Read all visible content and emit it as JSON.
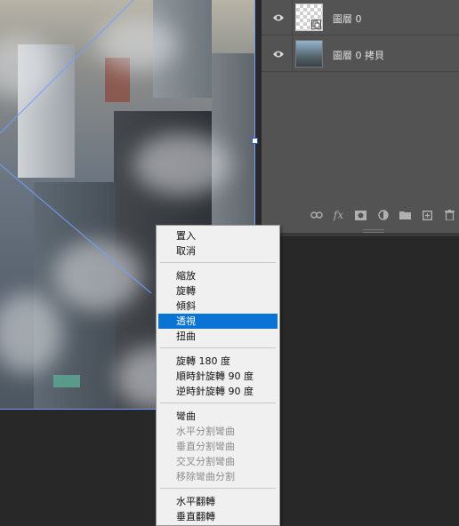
{
  "layers_panel": {
    "layers": [
      {
        "name": "圖層 0",
        "visible": true,
        "thumbnail": "transparent-checkerboard",
        "smart_object": true
      },
      {
        "name": "圖層 0 拷貝",
        "visible": true,
        "thumbnail": "city-photo",
        "smart_object": false
      }
    ],
    "footer_icons": [
      "link-icon",
      "fx-icon",
      "mask-icon",
      "adjustment-icon",
      "folder-icon",
      "new-layer-icon",
      "trash-icon"
    ],
    "fx_label": "fx"
  },
  "context_menu": {
    "sections": [
      {
        "items": [
          {
            "label": "置入",
            "enabled": true,
            "highlighted": false
          },
          {
            "label": "取消",
            "enabled": true,
            "highlighted": false
          }
        ]
      },
      {
        "items": [
          {
            "label": "縮放",
            "enabled": true,
            "highlighted": false
          },
          {
            "label": "旋轉",
            "enabled": true,
            "highlighted": false
          },
          {
            "label": "傾斜",
            "enabled": true,
            "highlighted": false
          },
          {
            "label": "透視",
            "enabled": true,
            "highlighted": true
          },
          {
            "label": "扭曲",
            "enabled": true,
            "highlighted": false
          }
        ]
      },
      {
        "items": [
          {
            "label": "旋轉 180 度",
            "enabled": true,
            "highlighted": false
          },
          {
            "label": "順時針旋轉 90 度",
            "enabled": true,
            "highlighted": false
          },
          {
            "label": "逆時針旋轉 90 度",
            "enabled": true,
            "highlighted": false
          }
        ]
      },
      {
        "items": [
          {
            "label": "彎曲",
            "enabled": true,
            "highlighted": false
          },
          {
            "label": "水平分割彎曲",
            "enabled": false,
            "highlighted": false
          },
          {
            "label": "垂直分割彎曲",
            "enabled": false,
            "highlighted": false
          },
          {
            "label": "交叉分割彎曲",
            "enabled": false,
            "highlighted": false
          },
          {
            "label": "移除彎曲分割",
            "enabled": false,
            "highlighted": false
          }
        ]
      },
      {
        "items": [
          {
            "label": "水平翻轉",
            "enabled": true,
            "highlighted": false
          },
          {
            "label": "垂直翻轉",
            "enabled": true,
            "highlighted": false
          }
        ]
      }
    ]
  },
  "colors": {
    "highlight": "#0a74d4",
    "transform_line": "#6fa0ff",
    "panel_bg": "#535353",
    "workspace_bg": "#282828"
  }
}
